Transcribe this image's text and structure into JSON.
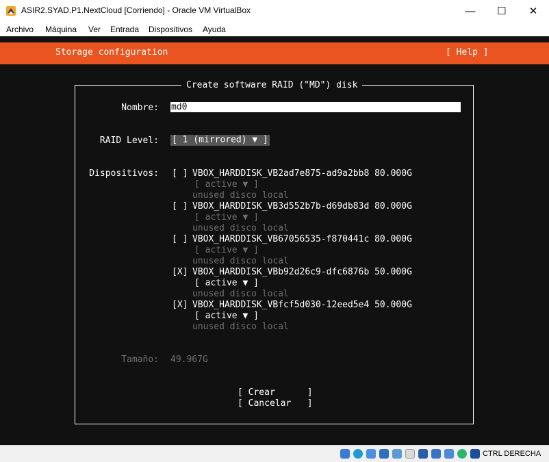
{
  "window": {
    "title": "ASIR2.SYAD.P1.NextCloud [Corriendo] - Oracle VM VirtualBox",
    "controls": {
      "minimize": "—",
      "maximize": "☐",
      "close": "✕"
    }
  },
  "menubar": {
    "items": [
      "Archivo",
      "Máquina",
      "Ver",
      "Entrada",
      "Dispositivos",
      "Ayuda"
    ]
  },
  "installer": {
    "header_title": "Storage configuration",
    "help_label": "[ Help ]",
    "dialog_title": "Create software RAID (\"MD\") disk",
    "name_label": "Nombre:",
    "name_value": "md0",
    "raid_label": "RAID Level:",
    "raid_value": "[ 1 (mirrored) ▼ ]",
    "devices_label": "Dispositivos:",
    "devices": [
      {
        "check": "[ ]",
        "name": "VBOX_HARDDISK_VB2ad7e875-ad9a2bb8 80.000G",
        "role": "[ active ▼ ]",
        "status": "unused disco local",
        "role_enabled": false
      },
      {
        "check": "[ ]",
        "name": "VBOX_HARDDISK_VB3d552b7b-d69db83d 80.000G",
        "role": "[ active ▼ ]",
        "status": "unused disco local",
        "role_enabled": false
      },
      {
        "check": "[ ]",
        "name": "VBOX_HARDDISK_VB67056535-f870441c 80.000G",
        "role": "[ active ▼ ]",
        "status": "unused disco local",
        "role_enabled": false
      },
      {
        "check": "[X]",
        "name": "VBOX_HARDDISK_VBb92d26c9-dfc6876b 50.000G",
        "role": "[ active ▼ ]",
        "status": "unused disco local",
        "role_enabled": true
      },
      {
        "check": "[X]",
        "name": "VBOX_HARDDISK_VBfcf5d030-12eed5e4 50.000G",
        "role": "[ active ▼ ]",
        "status": "unused disco local",
        "role_enabled": true
      }
    ],
    "size_label": "Tamaño:",
    "size_value": "49.967G",
    "create_button": "[ Crear      ]",
    "cancel_button": "[ Cancelar   ]"
  },
  "statusbar": {
    "host_key": "CTRL DERECHA",
    "icons": [
      "hard-disk-icon",
      "optical-drive-icon",
      "audio-icon",
      "network-icon",
      "usb-icon",
      "shared-folders-icon",
      "display-icon",
      "video-capture-icon",
      "virtualization-icon",
      "mouse-integration-icon",
      "keyboard-icon"
    ]
  },
  "colors": {
    "header": "#e95420",
    "terminal_bg": "#111111",
    "selection_bg": "#555555",
    "disabled_text": "#6e6e6e"
  }
}
